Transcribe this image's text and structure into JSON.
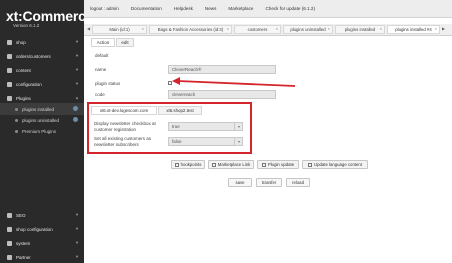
{
  "sidebar": {
    "logo": "xt:Commerce",
    "version": "Version 6.1.2",
    "items": [
      {
        "label": "shop"
      },
      {
        "label": "orders/customers"
      },
      {
        "label": "content"
      },
      {
        "label": "configuration"
      },
      {
        "label": "Plugins"
      },
      {
        "label": "plugins installed"
      },
      {
        "label": "plugins uninstalled"
      },
      {
        "label": "Premium Plugins"
      },
      {
        "label": "SEO"
      },
      {
        "label": "shop configuration"
      },
      {
        "label": "system"
      },
      {
        "label": "Partner"
      }
    ]
  },
  "topbar": {
    "links": [
      "logout : admin",
      "Documentation",
      "Helpdesk",
      "News",
      "Marketplace",
      "Check for update (6.1.2)"
    ]
  },
  "tabs": [
    "Main (id:1)",
    "Bags & Fashion Accessories (id:3)",
    "customers",
    "plugins uninstalled",
    "plugins installed",
    "plugins installed #4"
  ],
  "subtabs": [
    "Action",
    "edit"
  ],
  "form": {
    "section": "default",
    "name_label": "name",
    "name_value": "CleverReach®",
    "status_label": "plugin status",
    "code_label": "code",
    "code_value": "cleverreach"
  },
  "lang_tabs": [
    "xt6.xt-dev.logescom.com",
    "xt6.shop2.test"
  ],
  "settings": [
    {
      "label": "Display newsletter checkbox at customer registration",
      "value": "true"
    },
    {
      "label": "Set all existing customers as newsletter subscribers",
      "value": "false"
    }
  ],
  "action_buttons": [
    "hookpoints",
    "Marketplace Link",
    "Plugin update",
    "Update language content"
  ],
  "bottom_buttons": [
    "save",
    "transfer",
    "reload"
  ]
}
